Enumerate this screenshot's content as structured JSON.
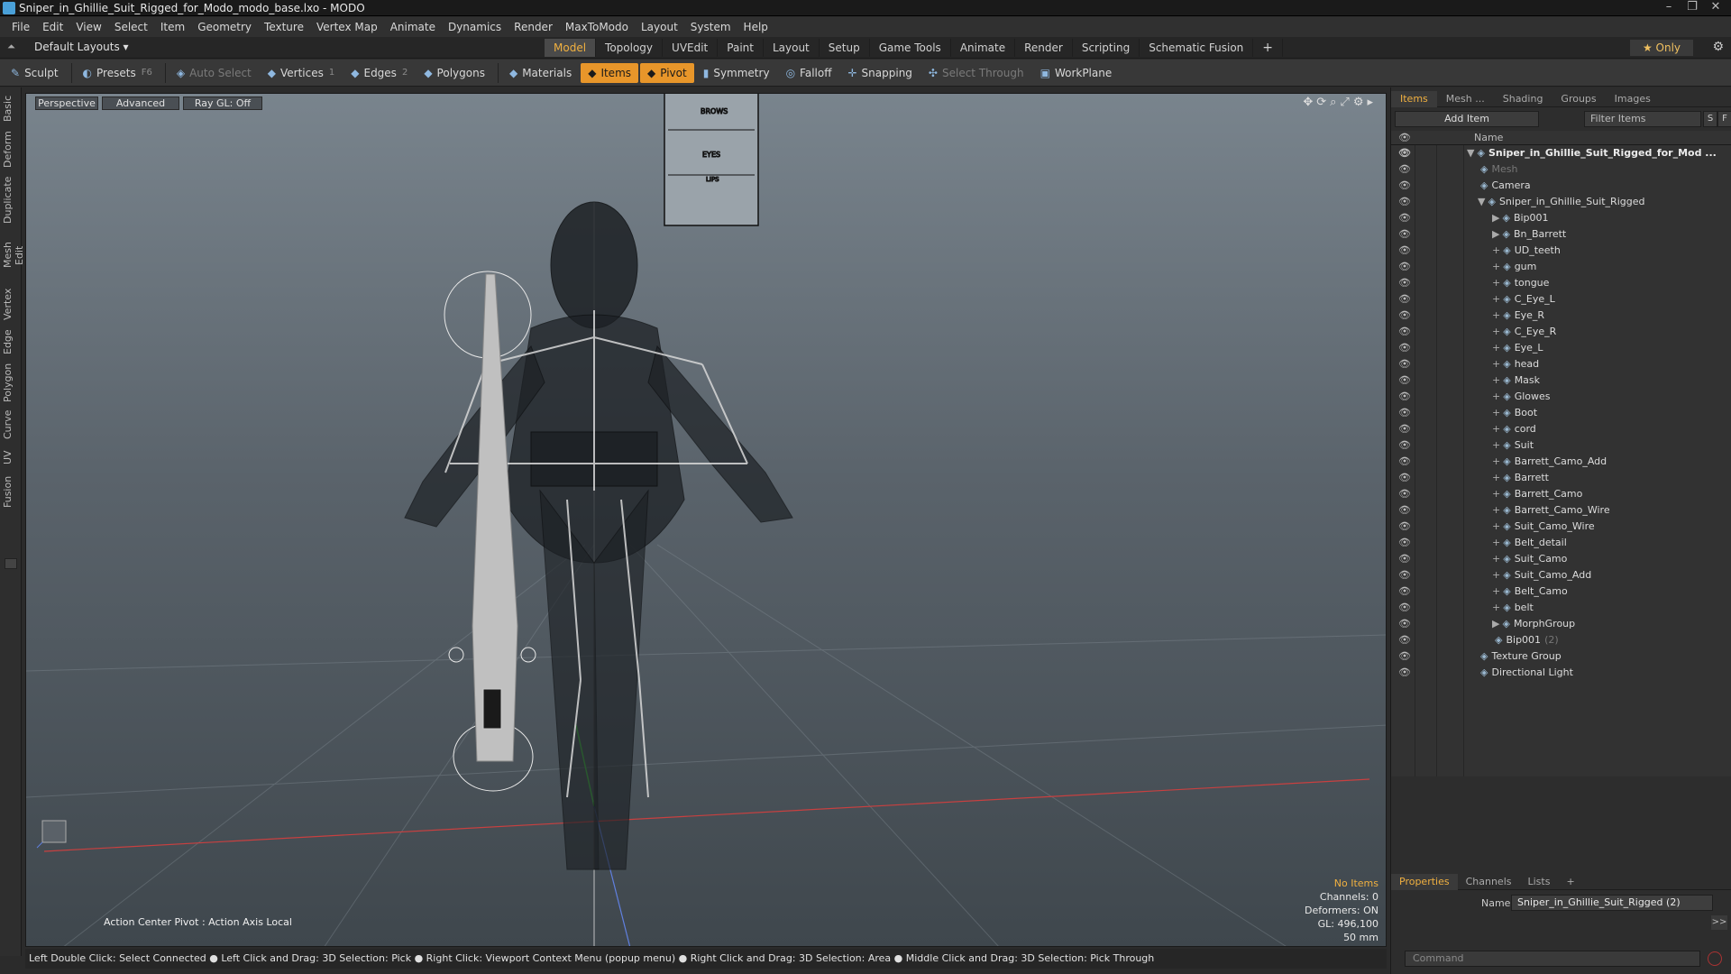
{
  "window": {
    "title": "Sniper_in_Ghillie_Suit_Rigged_for_Modo_modo_base.lxo - MODO"
  },
  "menu": [
    "File",
    "Edit",
    "View",
    "Select",
    "Item",
    "Geometry",
    "Texture",
    "Vertex Map",
    "Animate",
    "Dynamics",
    "Render",
    "MaxToModo",
    "Layout",
    "System",
    "Help"
  ],
  "layoutbar": {
    "default_layouts": "Default Layouts ▾",
    "tabs": [
      "Model",
      "Topology",
      "UVEdit",
      "Paint",
      "Layout",
      "Setup",
      "Game Tools",
      "Animate",
      "Render",
      "Scripting",
      "Schematic Fusion"
    ],
    "active_tab": "Model",
    "plus": "+",
    "only": "★ Only"
  },
  "toolbar": {
    "sculpt": "Sculpt",
    "presets": "Presets",
    "presets_key": "F6",
    "auto_select": "Auto Select",
    "vertices": "Vertices",
    "vertices_count": "1",
    "edges": "Edges",
    "edges_count": "2",
    "polygons": "Polygons",
    "materials": "Materials",
    "items": "Items",
    "pivot": "Pivot",
    "symmetry": "Symmetry",
    "falloff": "Falloff",
    "snapping": "Snapping",
    "select_through": "Select Through",
    "workplane": "WorkPlane"
  },
  "lefttabs": [
    "Basic",
    "Deform",
    "Duplicate",
    "Mesh Edit",
    "Vertex",
    "Edge",
    "Polygon",
    "Curve",
    "UV",
    "Fusion"
  ],
  "viewport": {
    "perspective": "Perspective",
    "advanced": "Advanced",
    "raygl": "Ray GL: Off",
    "action_center": "Action Center Pivot : Action Axis Local",
    "no_items": "No Items",
    "channels": "Channels: 0",
    "deformers": "Deformers: ON",
    "gl": "GL: 496,100",
    "focal": "50 mm"
  },
  "statusbar": "Left Double Click: Select Connected ● Left Click and Drag: 3D Selection: Pick ● Right Click: Viewport Context Menu (popup menu) ● Right Click and Drag: 3D Selection: Area ● Middle Click and Drag: 3D Selection: Pick Through",
  "rightpanel": {
    "tabs": [
      "Items",
      "Mesh ...",
      "Shading",
      "Groups",
      "Images"
    ],
    "add_item": "Add Item",
    "filter_placeholder": "Filter Items",
    "s_btn": "S",
    "f_btn": "F",
    "col_name": "Name",
    "tree": [
      {
        "label": "Sniper_in_Ghillie_Suit_Rigged_for_Mod ...",
        "depth": 0,
        "bold": true,
        "twirl": "▼"
      },
      {
        "label": "Mesh",
        "depth": 1,
        "dim": true,
        "twirl": ""
      },
      {
        "label": "Camera",
        "depth": 1,
        "twirl": ""
      },
      {
        "label": "Sniper_in_Ghillie_Suit_Rigged",
        "depth": 1,
        "twirl": "▼"
      },
      {
        "label": "Bip001",
        "depth": 2,
        "twirl": "▶"
      },
      {
        "label": "Bn_Barrett",
        "depth": 2,
        "twirl": "▶"
      },
      {
        "label": "UD_teeth",
        "depth": 2,
        "twirl": "+"
      },
      {
        "label": "gum",
        "depth": 2,
        "twirl": "+"
      },
      {
        "label": "tongue",
        "depth": 2,
        "twirl": "+"
      },
      {
        "label": "C_Eye_L",
        "depth": 2,
        "twirl": "+"
      },
      {
        "label": "Eye_R",
        "depth": 2,
        "twirl": "+"
      },
      {
        "label": "C_Eye_R",
        "depth": 2,
        "twirl": "+"
      },
      {
        "label": "Eye_L",
        "depth": 2,
        "twirl": "+"
      },
      {
        "label": "head",
        "depth": 2,
        "twirl": "+"
      },
      {
        "label": "Mask",
        "depth": 2,
        "twirl": "+"
      },
      {
        "label": "Glowes",
        "depth": 2,
        "twirl": "+"
      },
      {
        "label": "Boot",
        "depth": 2,
        "twirl": "+"
      },
      {
        "label": "cord",
        "depth": 2,
        "twirl": "+"
      },
      {
        "label": "Suit",
        "depth": 2,
        "twirl": "+"
      },
      {
        "label": "Barrett_Camo_Add",
        "depth": 2,
        "twirl": "+"
      },
      {
        "label": "Barrett",
        "depth": 2,
        "twirl": "+"
      },
      {
        "label": "Barrett_Camo",
        "depth": 2,
        "twirl": "+"
      },
      {
        "label": "Barrett_Camo_Wire",
        "depth": 2,
        "twirl": "+"
      },
      {
        "label": "Suit_Camo_Wire",
        "depth": 2,
        "twirl": "+"
      },
      {
        "label": "Belt_detail",
        "depth": 2,
        "twirl": "+"
      },
      {
        "label": "Suit_Camo",
        "depth": 2,
        "twirl": "+"
      },
      {
        "label": "Suit_Camo_Add",
        "depth": 2,
        "twirl": "+"
      },
      {
        "label": "Belt_Camo",
        "depth": 2,
        "twirl": "+"
      },
      {
        "label": "belt",
        "depth": 2,
        "twirl": "+"
      },
      {
        "label": "MorphGroup",
        "depth": 2,
        "twirl": "▶"
      },
      {
        "label": "Bip001",
        "depth": 2,
        "twirl": "",
        "suffix": "(2)"
      },
      {
        "label": "Texture Group",
        "depth": 1,
        "twirl": ""
      },
      {
        "label": "Directional Light",
        "depth": 1,
        "twirl": ""
      }
    ]
  },
  "properties": {
    "tabs": [
      "Properties",
      "Channels",
      "Lists",
      "+"
    ],
    "name_label": "Name",
    "name_value": "Sniper_in_Ghillie_Suit_Rigged (2)",
    "more": ">>"
  },
  "command": {
    "placeholder": "Command"
  },
  "colors": {
    "accent": "#e8962a",
    "active_text": "#f0b040"
  }
}
